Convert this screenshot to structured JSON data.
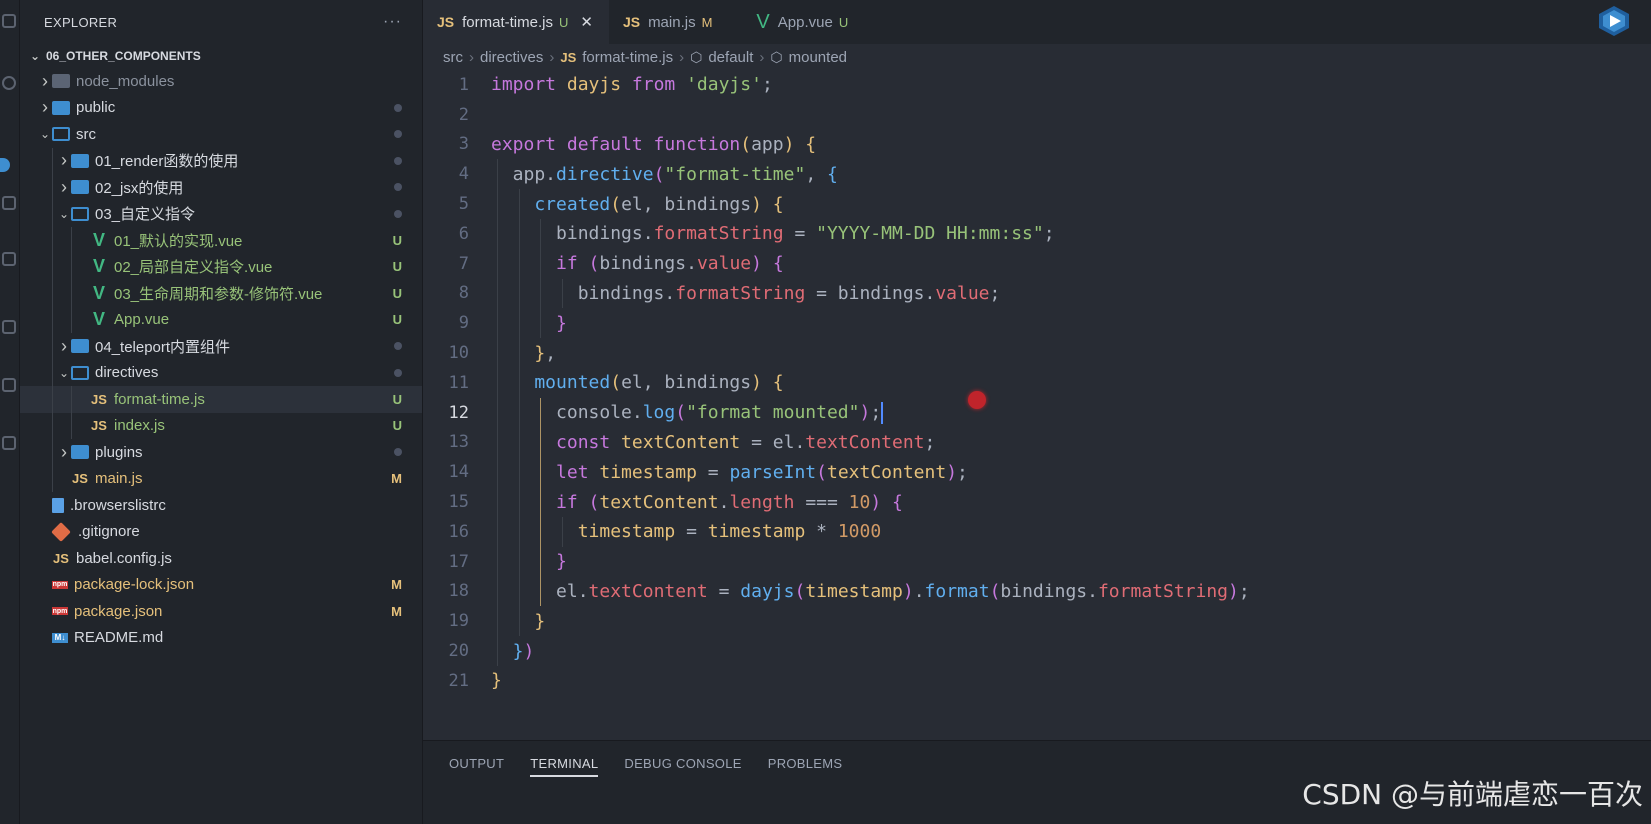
{
  "sidebar": {
    "title": "EXPLORER",
    "more": "···",
    "root": "06_OTHER_COMPONENTS",
    "items": [
      {
        "label": "node_modules",
        "icon": "folder-modules-icon",
        "depth": 0,
        "chev": ">",
        "status": ""
      },
      {
        "label": "public",
        "icon": "folder-icon",
        "depth": 0,
        "chev": ">",
        "status": "dot"
      },
      {
        "label": "src",
        "icon": "folder-open-icon",
        "depth": 0,
        "chev": "v",
        "status": "dot"
      },
      {
        "label": "01_render函数的使用",
        "icon": "folder-icon",
        "depth": 1,
        "chev": ">",
        "status": "dot"
      },
      {
        "label": "02_jsx的使用",
        "icon": "folder-icon",
        "depth": 1,
        "chev": ">",
        "status": "dot"
      },
      {
        "label": "03_自定义指令",
        "icon": "folder-open-icon",
        "depth": 1,
        "chev": "v",
        "status": "dot"
      },
      {
        "label": "01_默认的实现.vue",
        "icon": "vue-icon",
        "depth": 2,
        "chev": "",
        "status": "U"
      },
      {
        "label": "02_局部自定义指令.vue",
        "icon": "vue-icon",
        "depth": 2,
        "chev": "",
        "status": "U"
      },
      {
        "label": "03_生命周期和参数-修饰符.vue",
        "icon": "vue-icon",
        "depth": 2,
        "chev": "",
        "status": "U"
      },
      {
        "label": "App.vue",
        "icon": "vue-icon",
        "depth": 2,
        "chev": "",
        "status": "U"
      },
      {
        "label": "04_teleport内置组件",
        "icon": "folder-icon",
        "depth": 1,
        "chev": ">",
        "status": "dot"
      },
      {
        "label": "directives",
        "icon": "folder-open-icon",
        "depth": 1,
        "chev": "v",
        "status": "dot"
      },
      {
        "label": "format-time.js",
        "icon": "js-icon",
        "depth": 2,
        "chev": "",
        "status": "U",
        "active": true
      },
      {
        "label": "index.js",
        "icon": "js-icon",
        "depth": 2,
        "chev": "",
        "status": "U"
      },
      {
        "label": "plugins",
        "icon": "folder-icon",
        "depth": 1,
        "chev": ">",
        "status": "dot"
      },
      {
        "label": "main.js",
        "icon": "js-icon",
        "depth": 1,
        "chev": "",
        "status": "M"
      },
      {
        "label": ".browserslistrc",
        "icon": "file-icon",
        "depth": 0,
        "chev": "",
        "status": ""
      },
      {
        "label": ".gitignore",
        "icon": "git-icon",
        "depth": 0,
        "chev": "",
        "status": ""
      },
      {
        "label": "babel.config.js",
        "icon": "js-icon",
        "depth": 0,
        "chev": "",
        "status": ""
      },
      {
        "label": "package-lock.json",
        "icon": "npm-icon",
        "depth": 0,
        "chev": "",
        "status": "M"
      },
      {
        "label": "package.json",
        "icon": "npm-icon",
        "depth": 0,
        "chev": "",
        "status": "M"
      },
      {
        "label": "README.md",
        "icon": "md-icon",
        "depth": 0,
        "chev": "",
        "status": ""
      }
    ]
  },
  "tabs": [
    {
      "label": "format-time.js",
      "type": "JS",
      "status": "U",
      "active": true,
      "close": "✕"
    },
    {
      "label": "main.js",
      "type": "JS",
      "status": "M",
      "active": false
    },
    {
      "label": "App.vue",
      "type": "V",
      "status": "U",
      "active": false
    }
  ],
  "breadcrumb": {
    "parts": [
      "src",
      "directives",
      "format-time.js",
      "default",
      "mounted"
    ]
  },
  "editor": {
    "current_line": 12,
    "lines": [
      {
        "n": 1,
        "tokens": [
          [
            "kw",
            "import "
          ],
          [
            "var",
            "dayjs "
          ],
          [
            "kw",
            "from "
          ],
          [
            "str",
            "'dayjs'"
          ],
          [
            "pun",
            ";"
          ]
        ]
      },
      {
        "n": 2,
        "tokens": []
      },
      {
        "n": 3,
        "tokens": [
          [
            "kw",
            "export default function"
          ],
          [
            "br1",
            "("
          ],
          [
            "pun",
            "app"
          ],
          [
            "br1",
            ")"
          ],
          [
            "pun",
            " "
          ],
          [
            "br1",
            "{"
          ]
        ]
      },
      {
        "n": 4,
        "tokens": [
          [
            "pun",
            "  app."
          ],
          [
            "fn",
            "directive"
          ],
          [
            "br2",
            "("
          ],
          [
            "str",
            "\"format-time\""
          ],
          [
            "pun",
            ", "
          ],
          [
            "br3",
            "{"
          ]
        ]
      },
      {
        "n": 5,
        "tokens": [
          [
            "fn",
            "    created"
          ],
          [
            "br1",
            "("
          ],
          [
            "pun",
            "el, bindings"
          ],
          [
            "br1",
            ")"
          ],
          [
            "pun",
            " "
          ],
          [
            "br1",
            "{"
          ]
        ]
      },
      {
        "n": 6,
        "tokens": [
          [
            "pun",
            "      bindings."
          ],
          [
            "prop",
            "formatString"
          ],
          [
            "pun",
            " = "
          ],
          [
            "str",
            "\"YYYY-MM-DD HH:mm:ss\""
          ],
          [
            "pun",
            ";"
          ]
        ]
      },
      {
        "n": 7,
        "tokens": [
          [
            "kw",
            "      if "
          ],
          [
            "br2",
            "("
          ],
          [
            "pun",
            "bindings."
          ],
          [
            "prop",
            "value"
          ],
          [
            "br2",
            ")"
          ],
          [
            "pun",
            " "
          ],
          [
            "br2",
            "{"
          ]
        ]
      },
      {
        "n": 8,
        "tokens": [
          [
            "pun",
            "        bindings."
          ],
          [
            "prop",
            "formatString"
          ],
          [
            "pun",
            " = bindings."
          ],
          [
            "prop",
            "value"
          ],
          [
            "pun",
            ";"
          ]
        ]
      },
      {
        "n": 9,
        "tokens": [
          [
            "br2",
            "      }"
          ]
        ]
      },
      {
        "n": 10,
        "tokens": [
          [
            "br1",
            "    }"
          ],
          [
            "pun",
            ","
          ]
        ]
      },
      {
        "n": 11,
        "tokens": [
          [
            "fn",
            "    mounted"
          ],
          [
            "br1",
            "("
          ],
          [
            "pun",
            "el, bindings"
          ],
          [
            "br1",
            ")"
          ],
          [
            "pun",
            " "
          ],
          [
            "br1",
            "{"
          ]
        ]
      },
      {
        "n": 12,
        "tokens": [
          [
            "pun",
            "      console."
          ],
          [
            "fn",
            "log"
          ],
          [
            "br2",
            "("
          ],
          [
            "str",
            "\"format mounted\""
          ],
          [
            "br2",
            ")"
          ],
          [
            "pun",
            ";"
          ]
        ],
        "caret": true
      },
      {
        "n": 13,
        "tokens": [
          [
            "kw",
            "      const "
          ],
          [
            "var",
            "textContent"
          ],
          [
            "pun",
            " = el."
          ],
          [
            "prop",
            "textContent"
          ],
          [
            "pun",
            ";"
          ]
        ]
      },
      {
        "n": 14,
        "tokens": [
          [
            "kw",
            "      let "
          ],
          [
            "var",
            "timestamp"
          ],
          [
            "pun",
            " = "
          ],
          [
            "fn",
            "parseInt"
          ],
          [
            "br2",
            "("
          ],
          [
            "var",
            "textContent"
          ],
          [
            "br2",
            ")"
          ],
          [
            "pun",
            ";"
          ]
        ]
      },
      {
        "n": 15,
        "tokens": [
          [
            "kw",
            "      if "
          ],
          [
            "br2",
            "("
          ],
          [
            "var",
            "textContent"
          ],
          [
            "pun",
            "."
          ],
          [
            "prop",
            "length"
          ],
          [
            "pun",
            " === "
          ],
          [
            "num",
            "10"
          ],
          [
            "br2",
            ")"
          ],
          [
            "pun",
            " "
          ],
          [
            "br2",
            "{"
          ]
        ]
      },
      {
        "n": 16,
        "tokens": [
          [
            "var",
            "        timestamp"
          ],
          [
            "pun",
            " = "
          ],
          [
            "var",
            "timestamp"
          ],
          [
            "pun",
            " * "
          ],
          [
            "num",
            "1000"
          ]
        ]
      },
      {
        "n": 17,
        "tokens": [
          [
            "br2",
            "      }"
          ]
        ]
      },
      {
        "n": 18,
        "tokens": [
          [
            "pun",
            "      el."
          ],
          [
            "prop",
            "textContent"
          ],
          [
            "pun",
            " = "
          ],
          [
            "fn",
            "dayjs"
          ],
          [
            "br2",
            "("
          ],
          [
            "var",
            "timestamp"
          ],
          [
            "br2",
            ")"
          ],
          [
            "pun",
            "."
          ],
          [
            "fn",
            "format"
          ],
          [
            "br2",
            "("
          ],
          [
            "pun",
            "bindings."
          ],
          [
            "prop",
            "formatString"
          ],
          [
            "br2",
            ")"
          ],
          [
            "pun",
            ";"
          ]
        ]
      },
      {
        "n": 19,
        "tokens": [
          [
            "br1",
            "    }"
          ]
        ]
      },
      {
        "n": 20,
        "tokens": [
          [
            "br3",
            "  }"
          ],
          [
            "br2",
            ")"
          ]
        ]
      },
      {
        "n": 21,
        "tokens": [
          [
            "br1",
            "}"
          ]
        ]
      }
    ]
  },
  "panel": {
    "tabs": [
      "OUTPUT",
      "TERMINAL",
      "DEBUG CONSOLE",
      "PROBLEMS"
    ],
    "active": "TERMINAL"
  },
  "watermark": "CSDN @与前端虐恋一百次",
  "colors": {
    "accent": "#3e8ed0",
    "untracked": "#98c379",
    "modified": "#e5c07b",
    "vue": "#42b883",
    "record": "#c0242b"
  }
}
